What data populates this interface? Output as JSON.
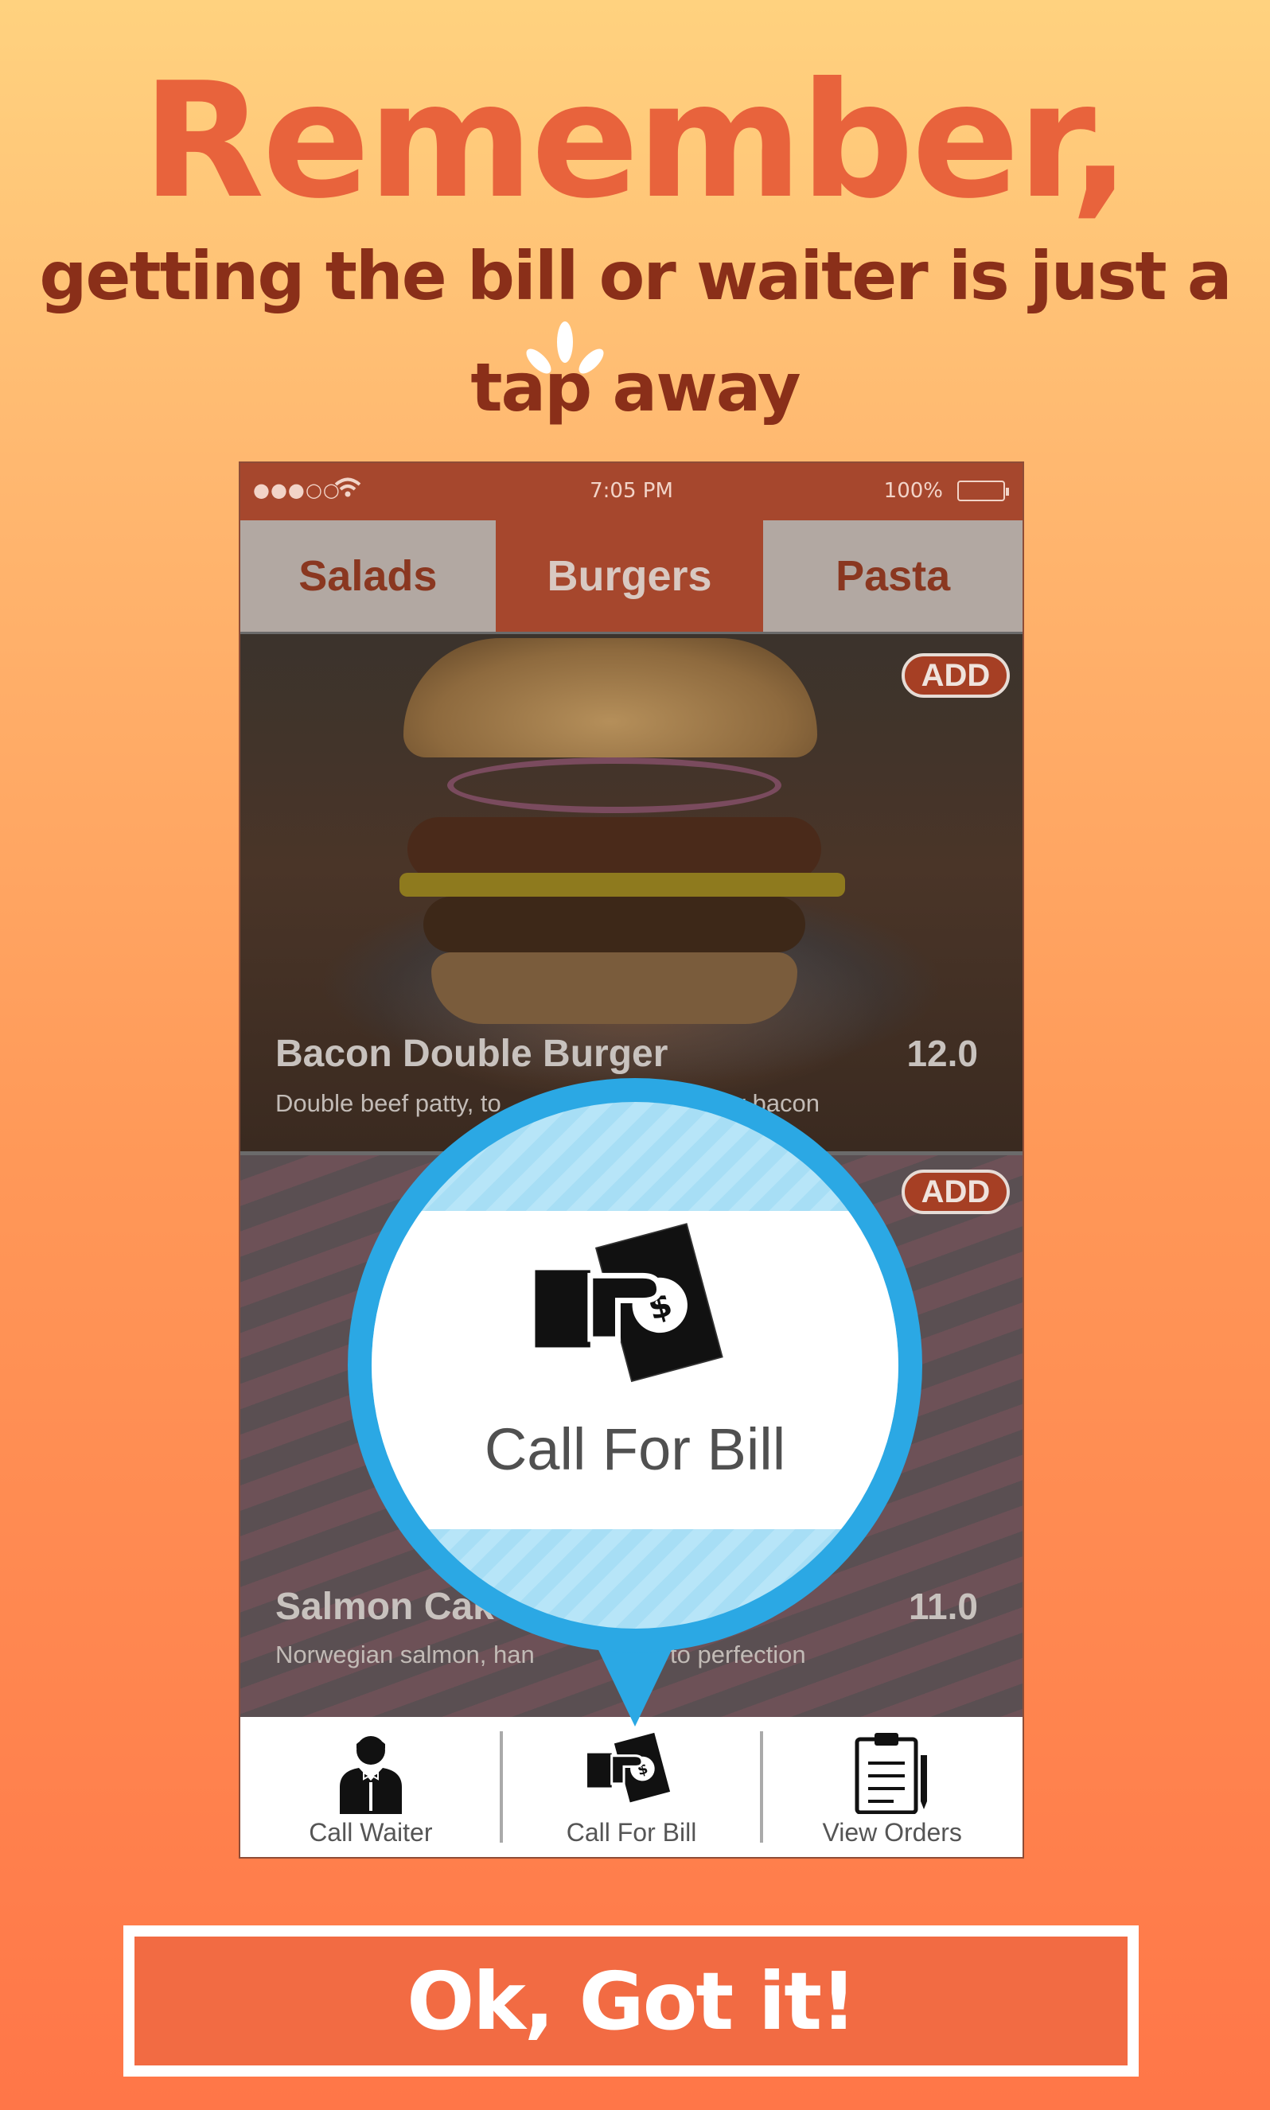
{
  "header": {
    "title": "Remember,",
    "line1": "getting the bill or waiter is just a",
    "line2": "tap away"
  },
  "status_bar": {
    "signal": "●●●○○",
    "time": "7:05 PM",
    "battery": "100%",
    "battery_level": 1.0
  },
  "tabs": [
    {
      "label": "Salads",
      "active": false
    },
    {
      "label": "Burgers",
      "active": true
    },
    {
      "label": "Pasta",
      "active": false
    }
  ],
  "dishes": [
    {
      "name": "Bacon Double Burger",
      "price": "12.0",
      "description": "Double beef patty, to",
      "description_tail": "streaky bacon",
      "add_label": "ADD"
    },
    {
      "name": "Salmon Cake",
      "price": "11.0",
      "description": "Norwegian salmon, han",
      "description_tail": "ed to perfection",
      "add_label": "ADD"
    }
  ],
  "toolbar": [
    {
      "label": "Call Waiter",
      "icon": "waiter-icon"
    },
    {
      "label": "Call For Bill",
      "icon": "bill-payment-icon"
    },
    {
      "label": "View Orders",
      "icon": "clipboard-icon"
    }
  ],
  "bubble": {
    "label": "Call For Bill",
    "icon": "bill-payment-icon"
  },
  "cta": {
    "label": "Ok, Got it!"
  },
  "colors": {
    "accent_dark": "#a6472d",
    "cta": "#f26b43",
    "bubble_ring": "#2ba8e4",
    "headline": "#e8633c",
    "subline": "#8a2f19"
  }
}
